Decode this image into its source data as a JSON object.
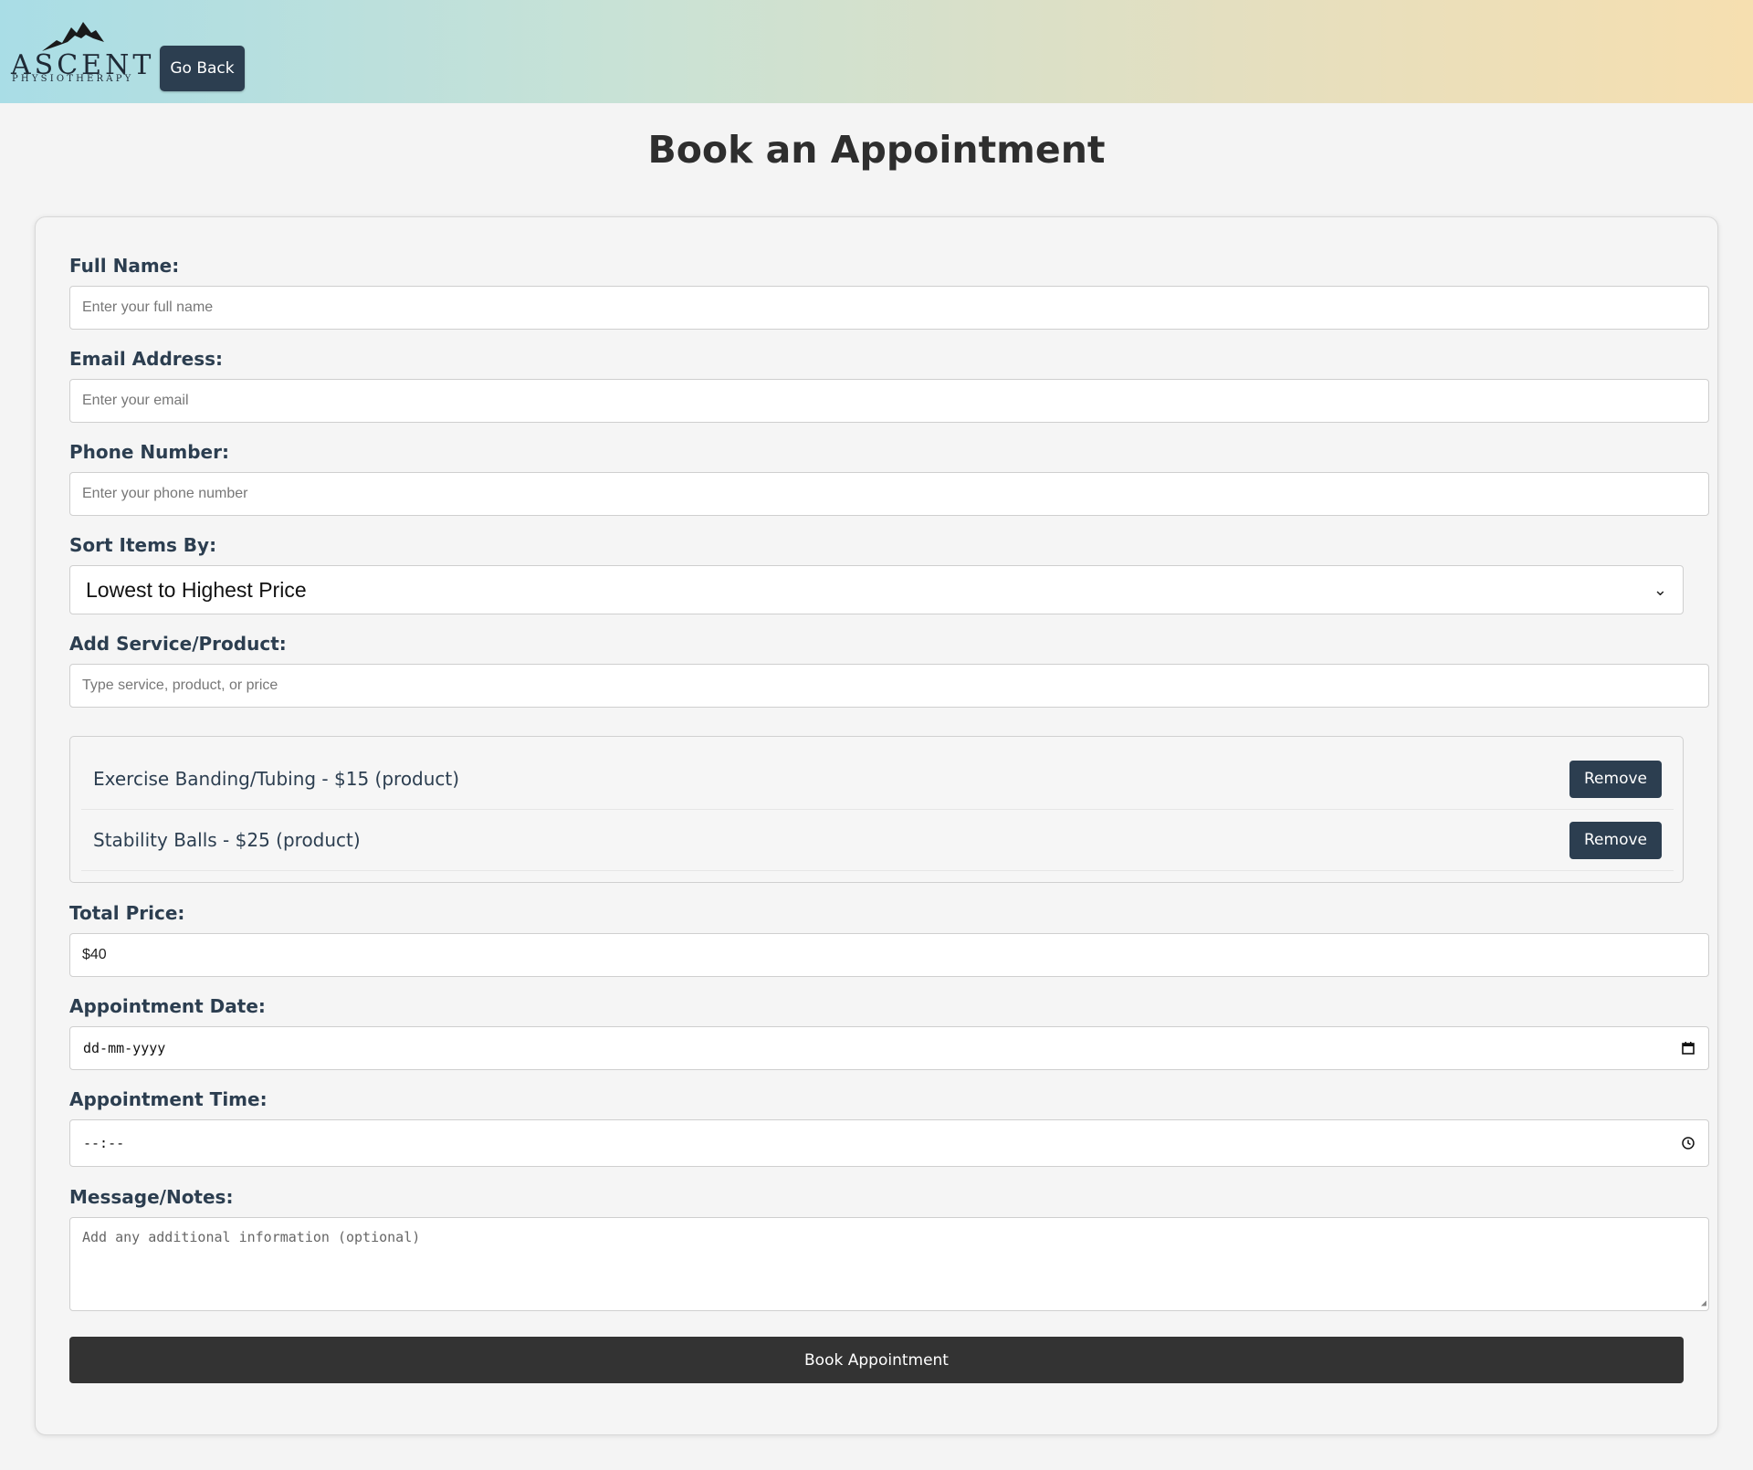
{
  "header": {
    "logo_text": "ASCENT",
    "logo_subtext": "PHYSIOTHERAPY",
    "back_label": "Go Back"
  },
  "page": {
    "title": "Book an Appointment"
  },
  "form": {
    "full_name": {
      "label": "Full Name:",
      "placeholder": "Enter your full name"
    },
    "email": {
      "label": "Email Address:",
      "placeholder": "Enter your email"
    },
    "phone": {
      "label": "Phone Number:",
      "placeholder": "Enter your phone number"
    },
    "sort": {
      "label": "Sort Items By:",
      "selected": "Lowest to Highest Price"
    },
    "add_item": {
      "label": "Add Service/Product:",
      "placeholder": "Type service, product, or price"
    },
    "items": [
      {
        "text": "Exercise Banding/Tubing - $15 (product)",
        "remove_label": "Remove"
      },
      {
        "text": "Stability Balls - $25 (product)",
        "remove_label": "Remove"
      }
    ],
    "total": {
      "label": "Total Price:",
      "value": "$40"
    },
    "date": {
      "label": "Appointment Date:",
      "placeholder": "dd-mm-yyyy"
    },
    "time": {
      "label": "Appointment Time:",
      "placeholder": "--:--"
    },
    "notes": {
      "label": "Message/Notes:",
      "placeholder": "Add any additional information (optional)"
    },
    "submit_label": "Book Appointment"
  },
  "icons": {
    "logo": "mountain-logo-icon",
    "select_arrow": "chevron-down-icon",
    "date": "calendar-icon",
    "time": "clock-icon",
    "textarea_resize": "resize-grip-icon"
  },
  "colors": {
    "primary_button": "#2c3e50",
    "submit_button": "#333333",
    "header_gradient_start": "#a9dde6",
    "header_gradient_end": "#f6dfb0"
  }
}
